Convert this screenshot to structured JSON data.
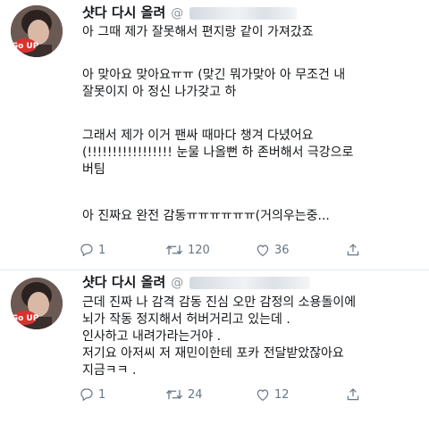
{
  "tweets": [
    {
      "author_name": "샷다 다시 올려",
      "handle": "@",
      "paragraphs": [
        "아 그때 제가 잘못해서 편지랑 같이 가져갔죠",
        "아 맞아요 맞아요ㅠㅠ (맞긴 뭐가맞아 아 무조건 내\n잘못이지 아 정신 나가갖고 하",
        "그래서 제가 이거 팬싸 때마다 챙겨 다녔어요\n(!!!!!!!!!!!!!!!!! 눈물 나올뻔 하 존버해서 극강으로\n버팀",
        "아 진짜요 완전 감동ㅠㅠㅠㅠㅠㅠ(거의우는중..."
      ],
      "replies": "1",
      "retweets": "120",
      "likes": "36"
    },
    {
      "author_name": "샷다 다시 올려",
      "handle": "@",
      "paragraphs": [
        "근데 진짜 나 감격 감동 진심 오만 감정의 소용돌이에\n뇌가 작동 정지해서 허버거리고 있는데 .\n인사하고 내려가라는거야 .\n저기요 아저씨 저 재민이한테 포카 전달받았잖아요\n지금ㅋㅋ ."
      ],
      "replies": "1",
      "retweets": "24",
      "likes": "12"
    }
  ],
  "avatar_badge": "Go UP",
  "colors": {
    "text": "#14171a",
    "secondary": "#657786",
    "divider": "#e6ecf0",
    "badge_red": "#d8322f"
  },
  "icons": [
    "reply-icon",
    "retweet-icon",
    "like-icon",
    "share-icon"
  ]
}
